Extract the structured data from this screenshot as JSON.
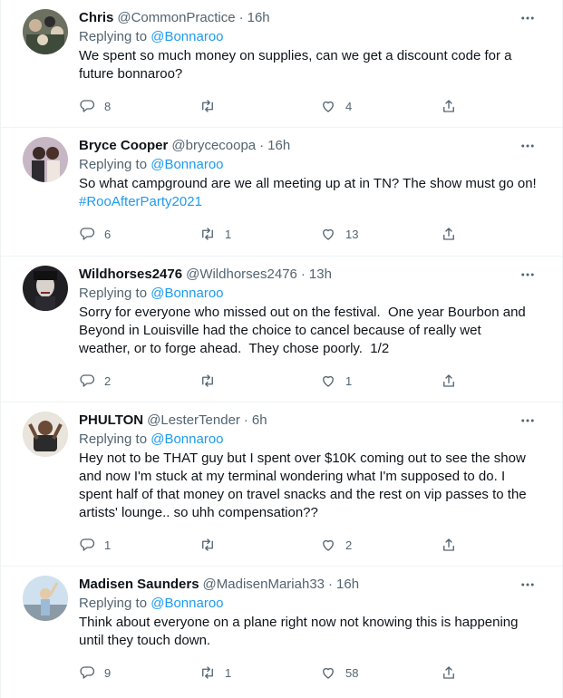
{
  "tweets": [
    {
      "name": "Chris",
      "handle": "@CommonPractice",
      "separator": "·",
      "time": "16h",
      "replying_prefix": "Replying to ",
      "replying_to": "@Bonnaroo",
      "text": "We spent so much money on supplies, can we get a discount code for a\nfuture bonnaroo?",
      "hashtag": "",
      "replies": "8",
      "retweets": "",
      "likes": "4"
    },
    {
      "name": "Bryce Cooper",
      "handle": "@brycecoopa",
      "separator": "·",
      "time": "16h",
      "replying_prefix": "Replying to ",
      "replying_to": "@Bonnaroo",
      "text": "So what campground are we all meeting up at in TN? The show must go on!\n",
      "hashtag": "#RooAfterParty2021",
      "replies": "6",
      "retweets": "1",
      "likes": "13"
    },
    {
      "name": "Wildhorses2476",
      "handle": "@Wildhorses2476",
      "separator": "·",
      "time": "13h",
      "replying_prefix": "Replying to ",
      "replying_to": "@Bonnaroo",
      "text": "Sorry for everyone who missed out on the festival.  One year Bourbon and\nBeyond in Louisville had the choice to cancel because of really wet\nweather, or to forge ahead.  They chose poorly.  1/2",
      "hashtag": "",
      "replies": "2",
      "retweets": "",
      "likes": "1"
    },
    {
      "name": "PHULTON",
      "handle": "@LesterTender",
      "separator": "·",
      "time": "6h",
      "replying_prefix": "Replying to ",
      "replying_to": "@Bonnaroo",
      "text": "Hey not to be THAT guy but I spent over $10K coming out to see the show\nand now I'm stuck at my terminal wondering what I'm supposed to do. I\nspent half of that money on travel snacks and the rest on vip passes to the\nartists' lounge.. so uhh compensation??",
      "hashtag": "",
      "replies": "1",
      "retweets": "",
      "likes": "2"
    },
    {
      "name": "Madisen Saunders",
      "handle": "@MadisenMariah33",
      "separator": "·",
      "time": "16h",
      "replying_prefix": "Replying to ",
      "replying_to": "@Bonnaroo",
      "text": "Think about everyone on a plane right now not knowing this is happening\nuntil they touch down.",
      "hashtag": "",
      "replies": "9",
      "retweets": "1",
      "likes": "58"
    }
  ],
  "icons": {
    "reply": "reply-icon",
    "retweet": "retweet-icon",
    "like": "like-icon",
    "share": "share-icon",
    "more": "more-icon"
  },
  "colors": {
    "text": "#0f1419",
    "muted": "#536471",
    "link": "#1d9bf0",
    "border": "#eff3f4"
  }
}
